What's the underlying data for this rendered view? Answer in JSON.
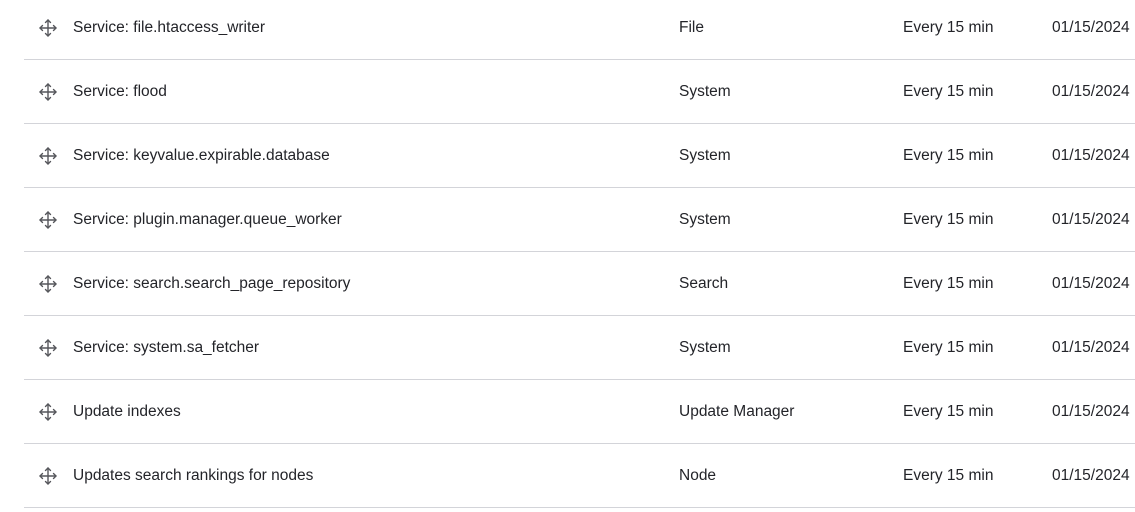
{
  "cron_jobs": {
    "rows": [
      {
        "title": "Service: file.htaccess_writer",
        "module": "File",
        "frequency": "Every 15 min",
        "date": "01/15/2024"
      },
      {
        "title": "Service: flood",
        "module": "System",
        "frequency": "Every 15 min",
        "date": "01/15/2024"
      },
      {
        "title": "Service: keyvalue.expirable.database",
        "module": "System",
        "frequency": "Every 15 min",
        "date": "01/15/2024"
      },
      {
        "title": "Service: plugin.manager.queue_worker",
        "module": "System",
        "frequency": "Every 15 min",
        "date": "01/15/2024"
      },
      {
        "title": "Service: search.search_page_repository",
        "module": "Search",
        "frequency": "Every 15 min",
        "date": "01/15/2024"
      },
      {
        "title": "Service: system.sa_fetcher",
        "module": "System",
        "frequency": "Every 15 min",
        "date": "01/15/2024"
      },
      {
        "title": "Update indexes",
        "module": "Update Manager",
        "frequency": "Every 15 min",
        "date": "01/15/2024"
      },
      {
        "title": "Updates search rankings for nodes",
        "module": "Node",
        "frequency": "Every 15 min",
        "date": "01/15/2024"
      }
    ]
  },
  "icons": {
    "handle": "drag-handle-icon"
  },
  "colors": {
    "text": "#232429",
    "divider": "#d3d4d9",
    "icon": "#55565b"
  }
}
